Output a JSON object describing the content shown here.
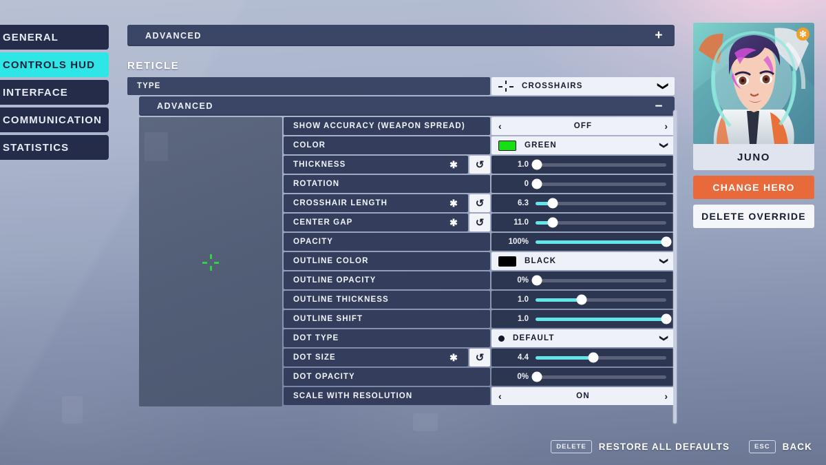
{
  "nav": {
    "items": [
      {
        "label": "GENERAL",
        "active": false
      },
      {
        "label": "CONTROLS HUD",
        "active": true
      },
      {
        "label": "INTERFACE",
        "active": false
      },
      {
        "label": "COMMUNICATION",
        "active": false
      },
      {
        "label": "STATISTICS",
        "active": false
      }
    ]
  },
  "top_bar": {
    "label": "ADVANCED",
    "toggle": "+"
  },
  "section": {
    "title": "RETICLE"
  },
  "type_row": {
    "label": "TYPE",
    "value": "CROSSHAIRS",
    "icon": "crosshair-icon",
    "chevron": "❯"
  },
  "advanced_bar": {
    "label": "ADVANCED",
    "toggle": "−"
  },
  "preview": {
    "crosshair_color": "#2fd446"
  },
  "rows": [
    {
      "label": "SHOW ACCURACY (WEAPON SPREAD)",
      "kind": "stepper",
      "value": "OFF",
      "left_arrow": "‹",
      "right_arrow": "›",
      "star": false,
      "reset": false
    },
    {
      "label": "COLOR",
      "kind": "dropdown",
      "value": "GREEN",
      "swatch": "#14e014",
      "chevron": "❯",
      "star": false,
      "reset": false
    },
    {
      "label": "THICKNESS",
      "kind": "slider",
      "value": "1.0",
      "percent": 1,
      "star": true,
      "reset": true
    },
    {
      "label": "ROTATION",
      "kind": "slider",
      "value": "0",
      "percent": 1,
      "star": false,
      "reset": false
    },
    {
      "label": "CROSSHAIR LENGTH",
      "kind": "slider",
      "value": "6.3",
      "percent": 13,
      "star": true,
      "reset": true
    },
    {
      "label": "CENTER GAP",
      "kind": "slider",
      "value": "11.0",
      "percent": 13,
      "star": true,
      "reset": true
    },
    {
      "label": "OPACITY",
      "kind": "slider",
      "value": "100%",
      "percent": 100,
      "star": false,
      "reset": false
    },
    {
      "label": "OUTLINE COLOR",
      "kind": "dropdown",
      "value": "BLACK",
      "swatch": "#000000",
      "chevron": "❯",
      "star": false,
      "reset": false
    },
    {
      "label": "OUTLINE OPACITY",
      "kind": "slider",
      "value": "0%",
      "percent": 1,
      "star": false,
      "reset": false
    },
    {
      "label": "OUTLINE THICKNESS",
      "kind": "slider",
      "value": "1.0",
      "percent": 35,
      "star": false,
      "reset": false
    },
    {
      "label": "OUTLINE SHIFT",
      "kind": "slider",
      "value": "1.0",
      "percent": 100,
      "star": false,
      "reset": false
    },
    {
      "label": "DOT TYPE",
      "kind": "dropdown-dot",
      "value": "DEFAULT",
      "chevron": "❯",
      "star": false,
      "reset": false
    },
    {
      "label": "DOT SIZE",
      "kind": "slider",
      "value": "4.4",
      "percent": 44,
      "star": true,
      "reset": true
    },
    {
      "label": "DOT OPACITY",
      "kind": "slider",
      "value": "0%",
      "percent": 1,
      "star": false,
      "reset": false
    },
    {
      "label": "SCALE WITH RESOLUTION",
      "kind": "stepper",
      "value": "ON",
      "left_arrow": "‹",
      "right_arrow": "›",
      "star": false,
      "reset": false
    }
  ],
  "hero": {
    "name": "JUNO",
    "badge": "✻",
    "change_label": "CHANGE HERO",
    "delete_label": "DELETE OVERRIDE"
  },
  "footer": {
    "restore_key": "DELETE",
    "restore_label": "RESTORE ALL DEFAULTS",
    "back_key": "ESC",
    "back_label": "BACK"
  },
  "colors": {
    "accent_cyan": "#2ee6e6",
    "slider_fill": "#64e5e8",
    "orange": "#e8693a",
    "row_dark": "#343e5c",
    "bar_dark": "#3b4666"
  },
  "reset_glyph": "↺",
  "star_glyph": "✱"
}
